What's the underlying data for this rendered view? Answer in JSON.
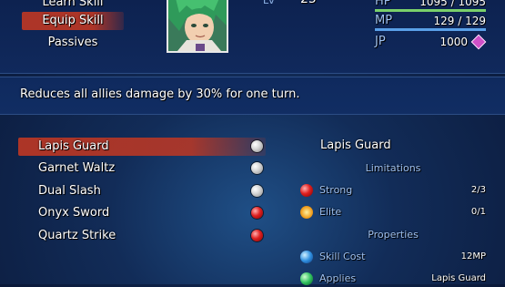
{
  "commands": [
    {
      "label": "Learn Skill",
      "selected": false
    },
    {
      "label": "Equip Skill",
      "selected": true
    },
    {
      "label": "Passives",
      "selected": false
    }
  ],
  "actor": {
    "level_label": "Lv",
    "level": "25",
    "hp": {
      "label": "HP",
      "current": "1095",
      "sep": "/",
      "max": "1095",
      "color": "#7ad06a",
      "fill": 1.0
    },
    "mp": {
      "label": "MP",
      "current": "129",
      "sep": "/",
      "max": "129",
      "color": "#5aa0e8",
      "fill": 1.0
    },
    "jp": {
      "label": "JP",
      "value": "1000"
    }
  },
  "help": {
    "text": "Reduces all allies damage by 30% for one turn."
  },
  "skills": [
    {
      "name": "Lapis Guard",
      "orb": "white",
      "selected": true
    },
    {
      "name": "Garnet Waltz",
      "orb": "white",
      "selected": false
    },
    {
      "name": "Dual Slash",
      "orb": "white",
      "selected": false
    },
    {
      "name": "Onyx Sword",
      "orb": "red",
      "selected": false
    },
    {
      "name": "Quartz Strike",
      "orb": "red",
      "selected": false
    }
  ],
  "detail": {
    "title": "Lapis Guard",
    "limitations_label": "Limitations",
    "limitations": [
      {
        "icon": "red-orb-icon",
        "label": "Strong",
        "value": "2/3"
      },
      {
        "icon": "sun-icon",
        "label": "Elite",
        "value": "0/1"
      }
    ],
    "properties_label": "Properties",
    "properties": [
      {
        "icon": "blue-orb-icon",
        "label": "Skill Cost",
        "value": "12MP"
      },
      {
        "icon": "green-orb-icon",
        "label": "Applies",
        "value": "Lapis Guard"
      }
    ]
  },
  "colors": {
    "selection": "#be3723",
    "label_blue": "#9ec0f0",
    "jp_gem": "#d050c8"
  }
}
